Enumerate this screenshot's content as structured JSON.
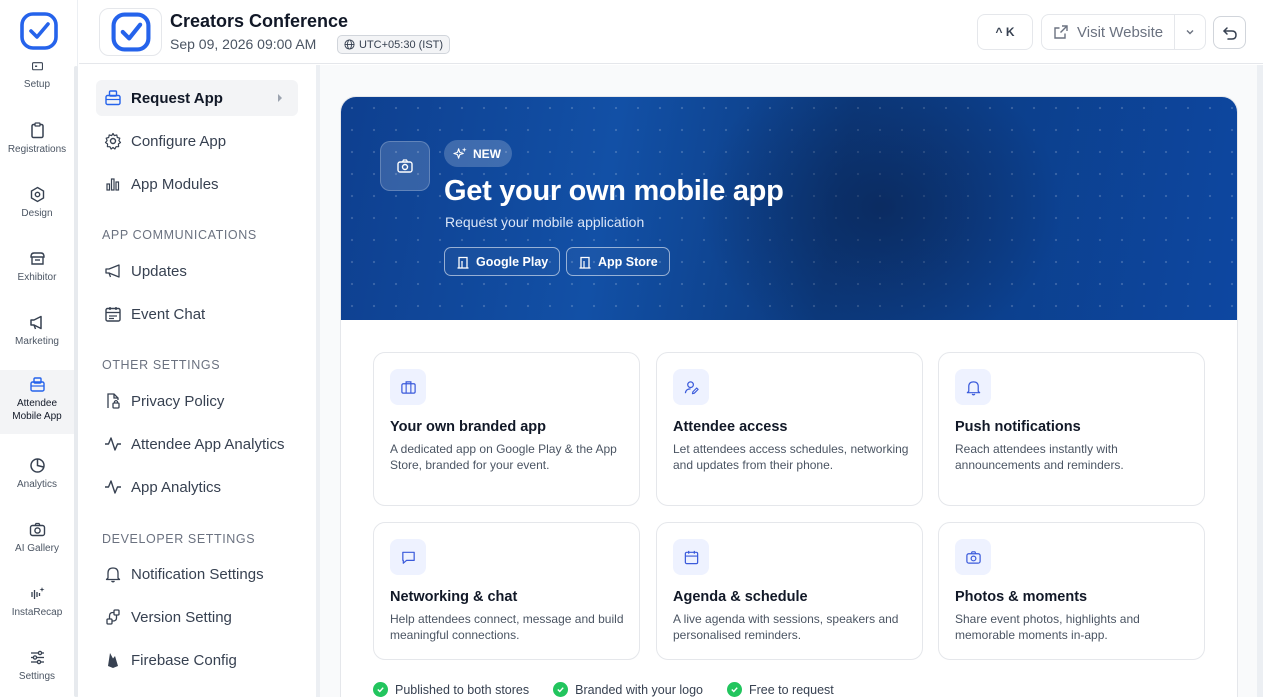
{
  "rail": {
    "items": [
      {
        "label": "Setup",
        "icon": "setup-icon"
      },
      {
        "label": "Registrations",
        "icon": "clipboard-icon"
      },
      {
        "label": "Design",
        "icon": "design-icon"
      },
      {
        "label": "Exhibitor",
        "icon": "store-icon"
      },
      {
        "label": "Marketing",
        "icon": "megaphone-icon"
      },
      {
        "label": "Attendee",
        "label2": "Mobile App",
        "icon": "mobile-app-icon",
        "active": true
      },
      {
        "label": "Analytics",
        "icon": "pie-chart-icon"
      },
      {
        "label": "AI Gallery",
        "icon": "camera-icon"
      },
      {
        "label": "InstaRecap",
        "icon": "sparkle-audio-icon"
      },
      {
        "label": "Settings",
        "icon": "sliders-icon"
      }
    ]
  },
  "header": {
    "event_title": "Creators Conference",
    "event_date": "Sep 09, 2026 09:00 AM",
    "timezone": "UTC+05:30 (IST)",
    "shortcut": "^ K",
    "visit_label": "Visit Website"
  },
  "subnav": {
    "items": [
      {
        "label": "Request App",
        "icon": "request-app-icon",
        "active": true
      },
      {
        "label": "Configure App",
        "icon": "gear-icon"
      },
      {
        "label": "App Modules",
        "icon": "bar-chart-icon"
      }
    ],
    "sections": [
      {
        "title": "APP COMMUNICATIONS",
        "items": [
          {
            "label": "Updates",
            "icon": "megaphone-icon"
          },
          {
            "label": "Event Chat",
            "icon": "calendar-chat-icon"
          }
        ]
      },
      {
        "title": "OTHER SETTINGS",
        "items": [
          {
            "label": "Privacy Policy",
            "icon": "file-lock-icon"
          },
          {
            "label": "Attendee App Analytics",
            "icon": "activity-icon"
          },
          {
            "label": "App Analytics",
            "icon": "activity-icon"
          }
        ]
      },
      {
        "title": "DEVELOPER SETTINGS",
        "items": [
          {
            "label": "Notification Settings",
            "icon": "bell-icon"
          },
          {
            "label": "Version Setting",
            "icon": "version-icon"
          },
          {
            "label": "Firebase Config",
            "icon": "firebase-icon"
          }
        ]
      }
    ]
  },
  "hero": {
    "badge": "NEW",
    "title": "Get your own mobile app",
    "subtitle": "Request your mobile application",
    "google_play": "Google Play",
    "app_store": "App Store"
  },
  "features": [
    {
      "title": "Your own branded app",
      "desc": "A dedicated app on Google Play & the App Store, branded for your event.",
      "icon": "briefcase-icon"
    },
    {
      "title": "Attendee access",
      "desc": "Let attendees access schedules, networking and updates from their phone.",
      "icon": "user-edit-icon"
    },
    {
      "title": "Push notifications",
      "desc": "Reach attendees instantly with announcements and reminders.",
      "icon": "bell-icon"
    },
    {
      "title": "Networking & chat",
      "desc": "Help attendees connect, message and build meaningful connections.",
      "icon": "chat-icon"
    },
    {
      "title": "Agenda & schedule",
      "desc": "A live agenda with sessions, speakers and personalised reminders.",
      "icon": "calendar-icon"
    },
    {
      "title": "Photos & moments",
      "desc": "Share event photos, highlights and memorable moments in-app.",
      "icon": "camera-icon"
    }
  ],
  "checks": [
    "Published to both stores",
    "Branded with your logo",
    "Free to request"
  ],
  "colors": {
    "brand": "#2563eb",
    "hero": "#0e3f8f",
    "check": "#22c55e"
  }
}
